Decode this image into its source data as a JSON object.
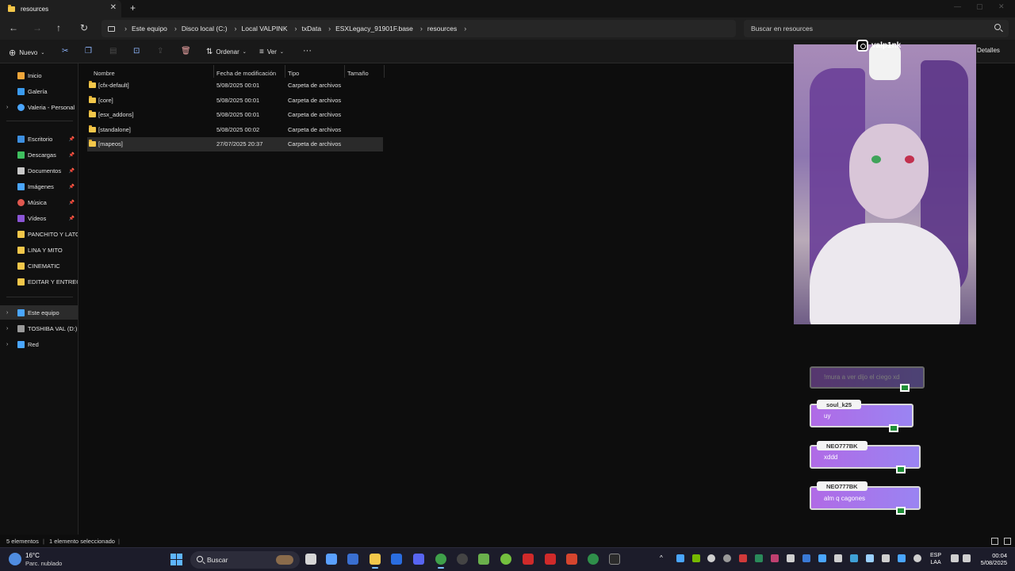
{
  "window": {
    "tab_title": "resources",
    "new_tab": "+",
    "close": "✕"
  },
  "nav": {
    "back": "←",
    "forward": "→",
    "up": "↑",
    "refresh": "↻"
  },
  "breadcrumb": [
    "Este equipo",
    "Disco local (C:)",
    "Local VALPINK",
    "txData",
    "ESXLegacy_91901F.base",
    "resources"
  ],
  "search": {
    "placeholder": "Buscar en resources"
  },
  "commandbar": {
    "new_label": "Nuevo",
    "sort_label": "Ordenar",
    "view_label": "Ver",
    "more_label": "···",
    "details_label": "Detalles"
  },
  "sidebar": {
    "items": [
      {
        "label": "Inicio",
        "color": "#f0a63a"
      },
      {
        "label": "Galería",
        "color": "#3a9bef"
      },
      {
        "label": "Valeria - Personal",
        "color": "#4aa6ff"
      },
      {
        "label": "Escritorio",
        "color": "#3d8fe0"
      },
      {
        "label": "Descargas",
        "color": "#3fbf5f"
      },
      {
        "label": "Documentos",
        "color": "#c9c9c9"
      },
      {
        "label": "Imágenes",
        "color": "#4aa6ff"
      },
      {
        "label": "Música",
        "color": "#e0584f"
      },
      {
        "label": "Vídeos",
        "color": "#8b55d6"
      },
      {
        "label": "PANCHITO Y LATO",
        "color": "#f3c74a"
      },
      {
        "label": "LINA Y MITO",
        "color": "#f3c74a"
      },
      {
        "label": "CINEMATIC",
        "color": "#f3c74a"
      },
      {
        "label": "EDITAR Y ENTREGA",
        "color": "#f3c74a"
      },
      {
        "label": "Este equipo",
        "color": "#4aa6ff"
      },
      {
        "label": "TOSHIBA VAL (D:)",
        "color": "#9a9a9a"
      },
      {
        "label": "Red",
        "color": "#4aa6ff"
      }
    ]
  },
  "table": {
    "headers": [
      "Nombre",
      "Fecha de modificación",
      "Tipo",
      "Tamaño"
    ],
    "rows": [
      {
        "name": "[cfx-default]",
        "date": "5/08/2025 00:01",
        "type": "Carpeta de archivos"
      },
      {
        "name": "[core]",
        "date": "5/08/2025 00:01",
        "type": "Carpeta de archivos"
      },
      {
        "name": "[esx_addons]",
        "date": "5/08/2025 00:01",
        "type": "Carpeta de archivos"
      },
      {
        "name": "[standalone]",
        "date": "5/08/2025 00:02",
        "type": "Carpeta de archivos"
      },
      {
        "name": "[mapeos]",
        "date": "27/07/2025 20:37",
        "type": "Carpeta de archivos"
      }
    ]
  },
  "status": {
    "count": "5 elementos",
    "selected": "1 elemento seleccionado",
    "bar": "|"
  },
  "overlay": {
    "ig_handle": "valp1nk",
    "chat": [
      {
        "name": "",
        "message": "!mura a ver dijo el ciego xd"
      },
      {
        "name": "soul_k25",
        "message": "uy"
      },
      {
        "name": "NEO777BK",
        "message": "xddd"
      },
      {
        "name": "NEO777BK",
        "message": "alm q cagones"
      }
    ]
  },
  "taskbar": {
    "temp": "16°C",
    "weather": "Parc. nublado",
    "search_placeholder": "Buscar",
    "lang_1": "ESP",
    "lang_2": "LAA",
    "time": "00:04",
    "date": "5/08/2025"
  }
}
